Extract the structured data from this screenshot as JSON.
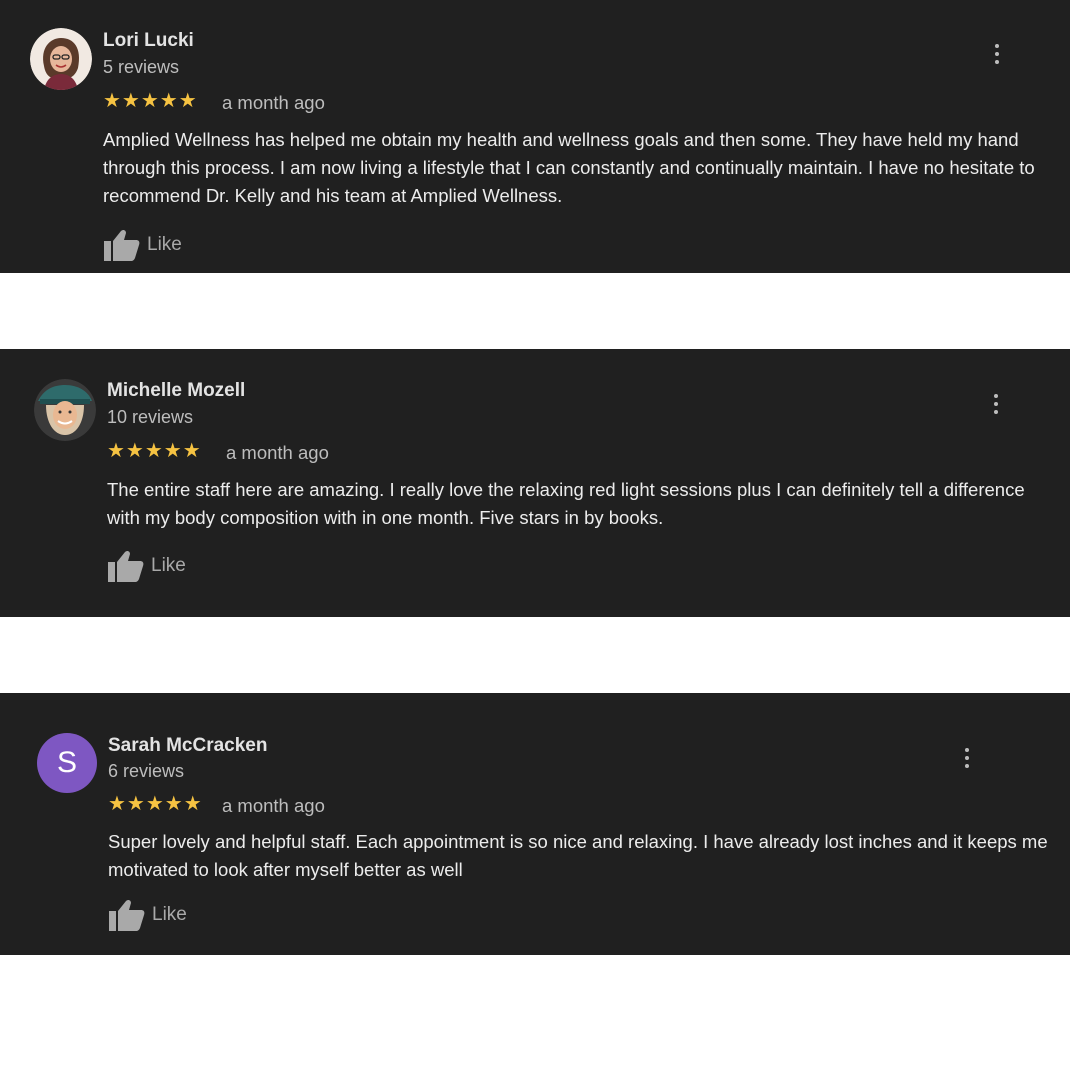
{
  "reviews": [
    {
      "name": "Lori Lucki",
      "review_count": "5 reviews",
      "stars": "★★★★★",
      "rating": 5,
      "time": "a month ago",
      "text": "Amplied Wellness has helped me obtain my health and wellness goals and then some.  They have held my hand through this process.  I am now living a lifestyle that I can constantly and continually maintain.  I have no hesitate to recommend Dr. Kelly and his team at Amplied Wellness.",
      "like_label": "Like",
      "avatar_type": "photo"
    },
    {
      "name": "Michelle Mozell",
      "review_count": "10 reviews",
      "stars": "★★★★★",
      "rating": 5,
      "time": "a month ago",
      "text": "The entire staff here are amazing. I really love the relaxing red light sessions plus I can definitely tell a difference with my body composition with in one month. Five stars in by books.",
      "like_label": "Like",
      "avatar_type": "photo"
    },
    {
      "name": "Sarah McCracken",
      "review_count": "6 reviews",
      "stars": "★★★★★",
      "rating": 5,
      "time": "a month ago",
      "text": "Super lovely and helpful staff. Each appointment is so nice and relaxing. I have already lost inches and it keeps me motivated to look after myself better as well",
      "like_label": "Like",
      "avatar_letter": "S",
      "avatar_color": "#7e57c2"
    }
  ],
  "colors": {
    "card_bg": "#202020",
    "star": "#f6c342",
    "page_bg": "#ffffff"
  }
}
